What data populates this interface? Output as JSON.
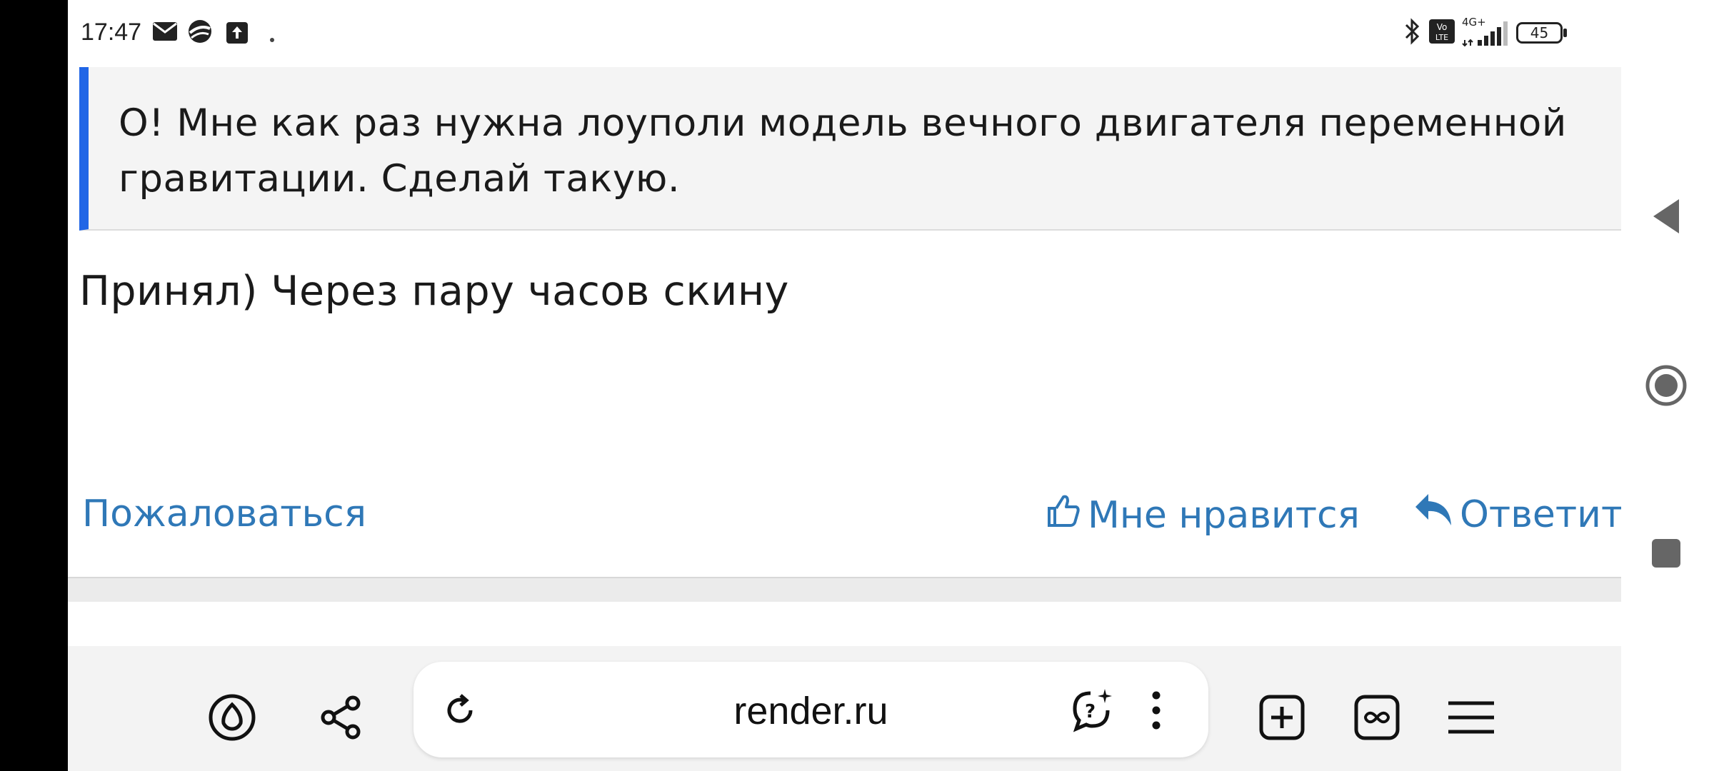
{
  "status_bar": {
    "time": "17:47",
    "battery_level": "45",
    "network_label": "4G+",
    "volte_label": "Vo LTE",
    "icons": [
      "mail-icon",
      "app-icon",
      "upload-icon",
      "dot-icon",
      "bluetooth-icon",
      "volte-icon",
      "signal-icon",
      "battery-icon"
    ]
  },
  "post": {
    "quote": "О! Мне как раз нужна лоуполи модель вечного двигателя переменной гравитации. Сделай такую.",
    "reply": "Принял) Через пару часов скину"
  },
  "actions": {
    "report_label": "Пожаловаться",
    "like_label": "Мне нравится",
    "answer_label": "Ответит"
  },
  "browser": {
    "url": "render.ru",
    "icons": [
      "alice-icon",
      "share-icon",
      "reload-icon",
      "ai-chat-icon",
      "more-icon",
      "new-tab-icon",
      "tabs-icon",
      "menu-icon"
    ]
  },
  "nav_bar": {
    "icons": [
      "back-icon",
      "home-icon",
      "recents-icon"
    ]
  },
  "colors": {
    "link": "#2f78b7",
    "quote_border": "#2166e6",
    "quote_bg": "#f4f4f4"
  }
}
